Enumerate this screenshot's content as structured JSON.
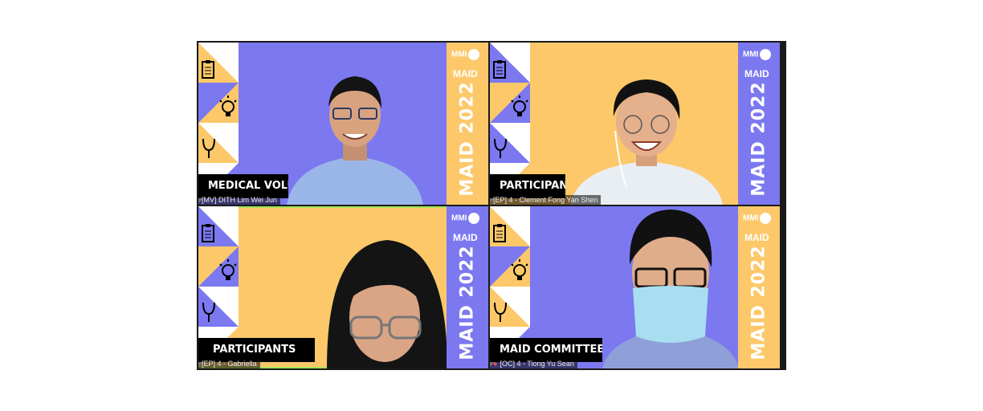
{
  "tiles": [
    {
      "nameplate": "MEDICAL VOLUN",
      "caption": "[MV] DITH Lim Wei Jun",
      "logo_top": "MMI",
      "logo_maid": "MAID",
      "vertical_text": "MAID 2022"
    },
    {
      "nameplate": "PARTICIPAN",
      "caption": "[EP] 4 - Clement Fong Yan Shen",
      "logo_top": "MMI",
      "logo_maid": "MAID",
      "vertical_text": "MAID 2022"
    },
    {
      "nameplate": "PARTICIPANTS",
      "caption": "[EP] 4 - Gabriella",
      "logo_top": "MMI",
      "logo_maid": "MAID",
      "vertical_text": "MAID 2022"
    },
    {
      "nameplate": "MAID COMMITTEE",
      "caption": "[OC] 4 - Tiong Yu Sean",
      "logo_top": "MMI",
      "logo_maid": "MAID",
      "vertical_text": "MAID 2022",
      "mic_muted": true
    }
  ],
  "colors": {
    "purple": "#7b78f0",
    "yellow": "#fcc86a",
    "active_border": "#a6e35a"
  },
  "icons": [
    "clipboard-icon",
    "lightbulb-icon",
    "stethoscope-icon"
  ]
}
